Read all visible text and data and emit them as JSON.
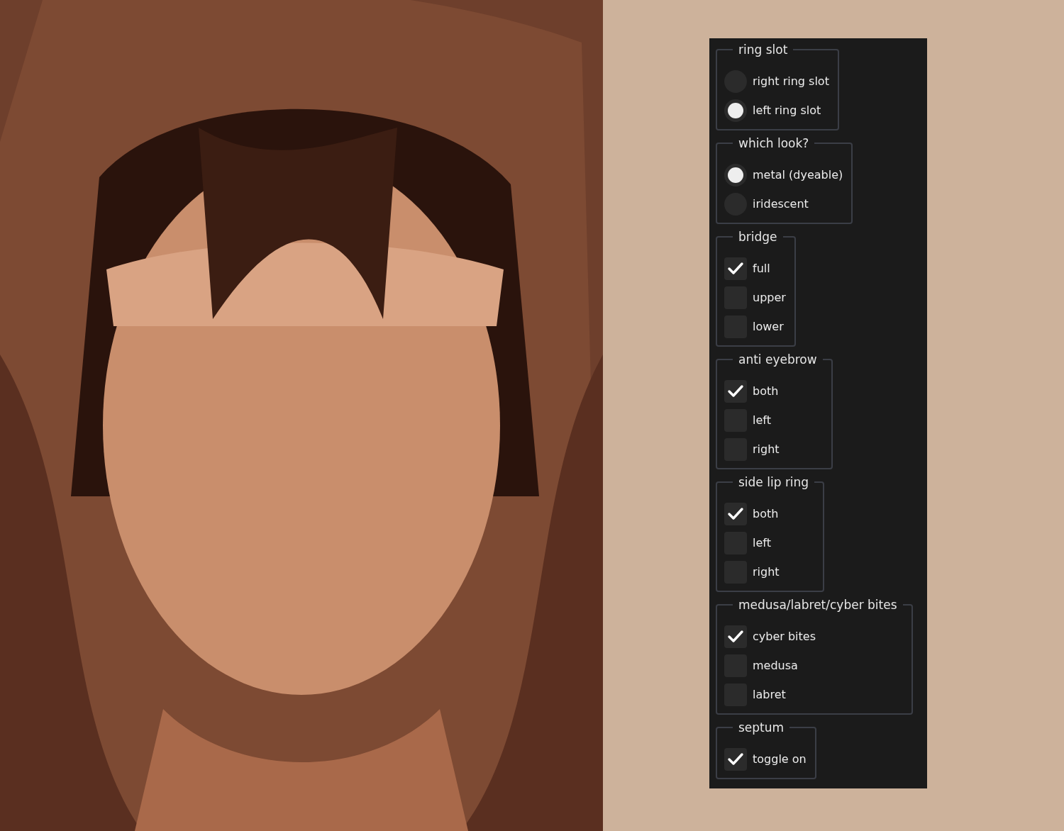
{
  "panel": {
    "groups": [
      {
        "legend": "ring slot",
        "kind": "radio",
        "options": [
          {
            "label": "right ring slot",
            "selected": false
          },
          {
            "label": "left ring slot",
            "selected": true
          }
        ]
      },
      {
        "legend": "which look?",
        "kind": "radio",
        "options": [
          {
            "label": "metal (dyeable)",
            "selected": true
          },
          {
            "label": "iridescent",
            "selected": false
          }
        ]
      },
      {
        "legend": "bridge",
        "kind": "checkbox",
        "options": [
          {
            "label": "full",
            "checked": true
          },
          {
            "label": "upper",
            "checked": false
          },
          {
            "label": "lower",
            "checked": false
          }
        ]
      },
      {
        "legend": "anti eyebrow",
        "kind": "checkbox",
        "options": [
          {
            "label": "both",
            "checked": true
          },
          {
            "label": "left",
            "checked": false
          },
          {
            "label": "right",
            "checked": false
          }
        ]
      },
      {
        "legend": "side lip ring",
        "kind": "checkbox",
        "options": [
          {
            "label": "both",
            "checked": true
          },
          {
            "label": "left",
            "checked": false
          },
          {
            "label": "right",
            "checked": false
          }
        ]
      },
      {
        "legend": "medusa/labret/cyber bites",
        "kind": "checkbox",
        "options": [
          {
            "label": "cyber bites",
            "checked": true
          },
          {
            "label": "medusa",
            "checked": false
          },
          {
            "label": "labret",
            "checked": false
          }
        ]
      },
      {
        "legend": "septum",
        "kind": "checkbox",
        "options": [
          {
            "label": "toggle on",
            "checked": true
          }
        ]
      }
    ]
  }
}
